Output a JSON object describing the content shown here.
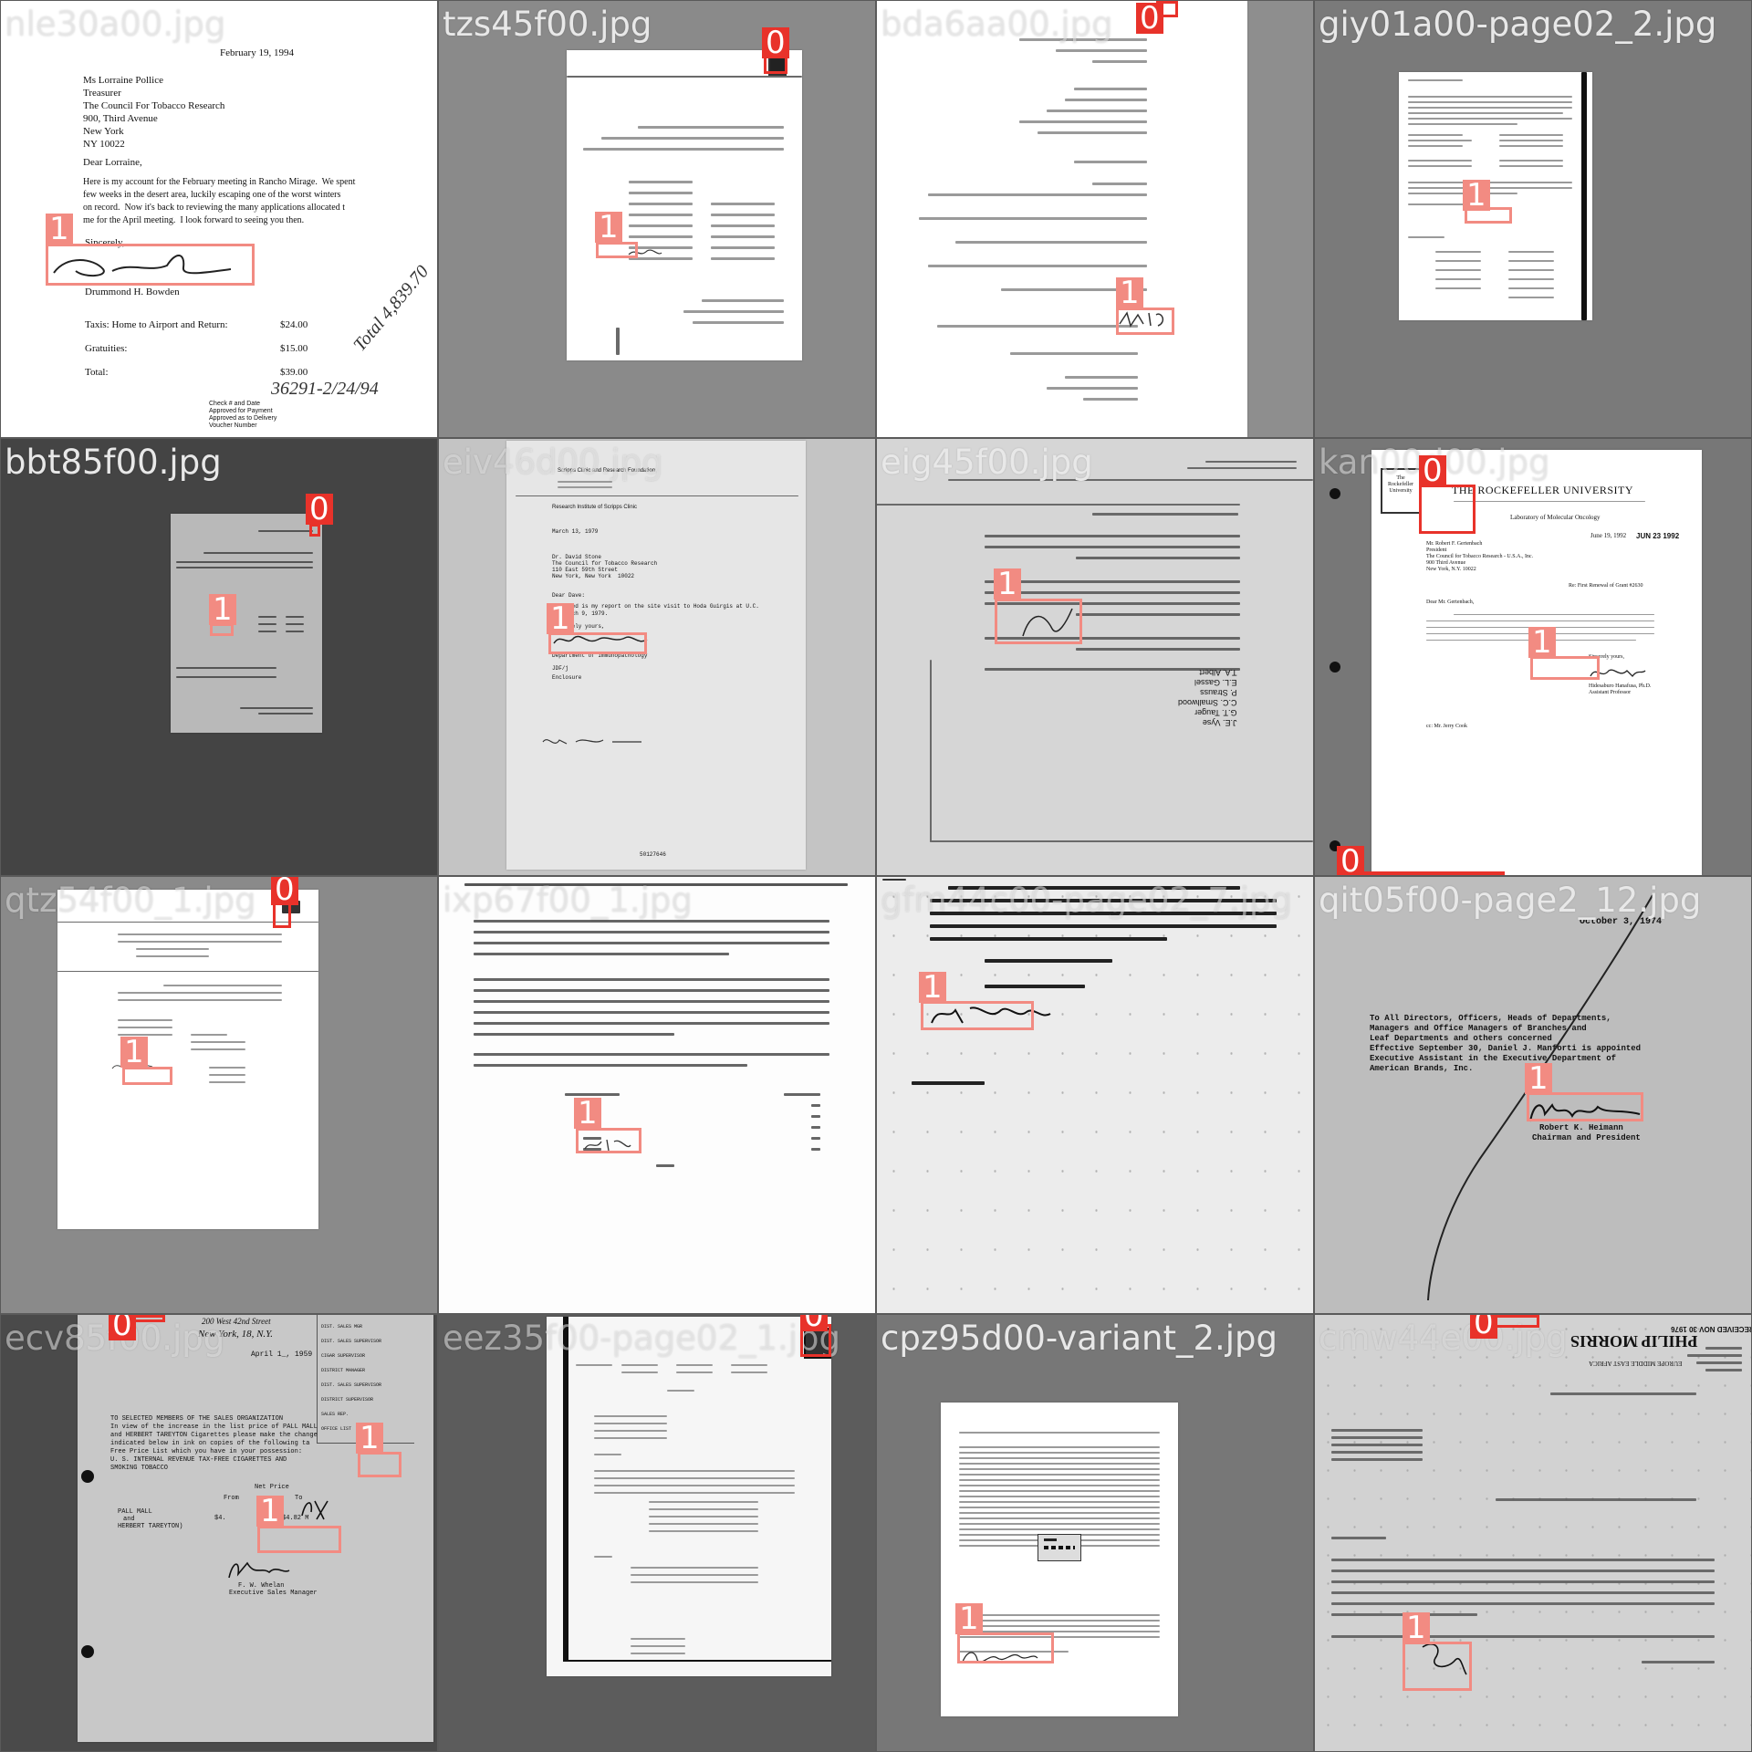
{
  "tiles": [
    {
      "filename": "nle30a00.jpg",
      "letter_date": "February 19, 1994",
      "address": [
        "Ms Lorraine Pollice",
        "Treasurer",
        "The Council For Tobacco Research",
        "900, Third Avenue",
        "New York",
        "NY 10022"
      ],
      "salutation": "Dear Lorraine,",
      "body": [
        "Here is my account for the February meeting in Rancho Mirage.  We spent",
        "few weeks in the desert area, luckily escaping one of the worst winters",
        "on record.  Now it's back to reviewing the many applications allocated t",
        "me for the April meeting.  I look forward to seeing you then."
      ],
      "closing": "Sincerely,",
      "signer": "Drummond H. Bowden",
      "items": [
        {
          "label": "Taxis: Home to Airport and Return:",
          "amount": "$24.00"
        },
        {
          "label": "Gratuities:",
          "amount": "$15.00"
        },
        {
          "label": "Total:",
          "amount": "$39.00"
        }
      ],
      "handwritten_total": "Total 4,839.70",
      "handwritten_check": "36291-2/24/94",
      "footer_fields": [
        "Check # and Date",
        "Approved for Payment",
        "Approved as to Delivery",
        "Voucher Number"
      ],
      "boxes": [
        "1"
      ]
    },
    {
      "filename": "tzs45f00.jpg",
      "boxes": [
        "0",
        "1"
      ]
    },
    {
      "filename": "bda6aa00.jpg",
      "boxes": [
        "0",
        "1"
      ]
    },
    {
      "filename": "giy01a00-page02_2.jpg",
      "boxes": [
        "1"
      ]
    },
    {
      "filename": "bbt85f00.jpg",
      "boxes": [
        "0",
        "1"
      ]
    },
    {
      "filename": "eiv46d00.jpg",
      "header": "Scripps Clinic and Research Foundation",
      "dept": "Research Institute of Scripps Clinic",
      "date": "March 13, 1979",
      "address": [
        "Dr. David Stone",
        "The Council for Tobacco Research",
        "110 East 59th Street",
        "New York, New York  10022"
      ],
      "salutation": "Dear Dave:",
      "body": [
        "Attached is my report on the site visit to Hoda Guirgis at U.C.",
        "on March 9, 1979."
      ],
      "closing": "Sincerely yours,",
      "dept_sig": "Department of Immunopathology",
      "initials": "JDF/j",
      "enclosure": "Enclosure",
      "doc_number": "50127646",
      "boxes": [
        "1"
      ]
    },
    {
      "filename": "eig45f00.jpg",
      "cc": [
        "T.A. Albert",
        "E.L. Gassel",
        "P. Strauss",
        "C.C. Smallwood",
        "G.T. Tauger",
        "J.E. Vyse"
      ],
      "boxes": [
        "1"
      ]
    },
    {
      "filename": "kan00d00.jpg",
      "university": "THE ROCKEFELLER UNIVERSITY",
      "lab": "Laboratory of Molecular Oncology",
      "date": "June 19, 1992",
      "stamp": "JUN 23 1992",
      "seal_text": "The Rockefeller University",
      "address": [
        "Mr. Robert F. Gertenbach",
        "President",
        "The Council for Tobacco Research - U.S.A., Inc.",
        "900 Third Avenue",
        "New York, N.Y. 10022"
      ],
      "re_line": "Re: First Renewal of Grant #2630",
      "salutation": "Dear Mr. Gertenbach,",
      "closing": "Sincerely yours,",
      "signer": [
        "Hidesaburo Hanafusa, Ph.D.",
        "Assistant Professor"
      ],
      "cc": "cc: Mr. Jerry Cook",
      "boxes": [
        "0",
        "1",
        "0"
      ]
    },
    {
      "filename": "qtz54f00_1.jpg",
      "boxes": [
        "0",
        "1"
      ]
    },
    {
      "filename": "ixp67f00_1.jpg",
      "boxes": [
        "1"
      ]
    },
    {
      "filename": "gfm44c00-page02_7.jpg",
      "closing": "Sincerely yours,",
      "regards": "With best regards,",
      "enclosure": "Enclosure",
      "boxes": [
        "1"
      ]
    },
    {
      "filename": "qit05f00-page2_12.jpg",
      "date": "October 3, 1974",
      "body": [
        "To All Directors, Officers, Heads of Departments,",
        "Managers and Office Managers of Branches and",
        "Leaf Departments and others concerned",
        "",
        "Effective September 30, Daniel J. Manforti is appointed",
        "Executive Assistant in the Executive Department of",
        "American Brands, Inc."
      ],
      "signer": [
        "Robert K. Heimann",
        "Chairman and President"
      ],
      "boxes": [
        "1"
      ]
    },
    {
      "filename": "ecv85f00.jpg",
      "address_script": [
        "200 West 42nd Street",
        "New York, 18, N.Y."
      ],
      "date": "April 1_, 1959",
      "routing": [
        "DIST. SALES MGR",
        "DIST. SALES SUPERVISOR",
        "CIGAR SUPERVISOR",
        "DISTRICT MANAGER",
        "DIST. SALES SUPERVISOR",
        "DISTRICT SUPERVISOR",
        "SALES REP.",
        "OFFICE LIST"
      ],
      "body": [
        "TO SELECTED MEMBERS OF THE SALES ORGANIZATION",
        "In view of the increase in the list price of PALL MALL",
        "and HERBERT TAREYTON Cigarettes please make the change",
        "indicated below in ink on copies of the following ta",
        "Free Price List which you have in your possession:",
        "",
        "U. S. INTERNAL REVENUE TAX-FREE CIGARETTES AND",
        "SMOKING TOBACCO"
      ],
      "price_header": "Net Price",
      "price_cols": [
        "From",
        "To"
      ],
      "price_item": [
        "PALL MALL",
        "and",
        "HERBERT TAREYTON)"
      ],
      "price_from": "$4.",
      "price_to": "$4.82 M",
      "signer": [
        "F. W. Whelan",
        "Executive Sales Manager"
      ],
      "boxes": [
        "0",
        "1",
        "1"
      ]
    },
    {
      "filename": "eez35f00-page02_1.jpg",
      "boxes": [
        "0"
      ]
    },
    {
      "filename": "cpz95d00-variant_2.jpg",
      "boxes": [
        "1"
      ]
    },
    {
      "filename": "cmw44e00.jpg",
      "company": "PHILIP MORRIS",
      "region": "EUROPE MIDDLE EAST AFRICA",
      "stamp": "RECEIVED NOV 30 1976",
      "boxes": [
        "0",
        "1"
      ]
    }
  ],
  "colors": {
    "box_label": "#f28b82",
    "box_label_strong": "#e8322a"
  }
}
